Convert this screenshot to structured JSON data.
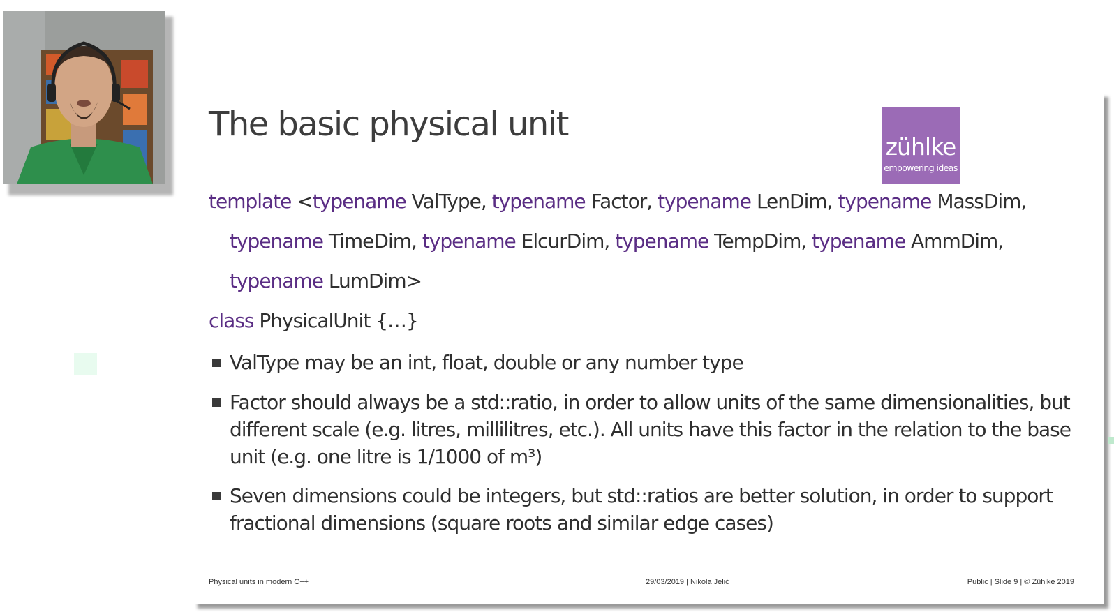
{
  "slide": {
    "title": "The basic physical unit",
    "logo": {
      "name": "zühlke",
      "tagline": "empowering ideas",
      "color": "#9b6bb6"
    },
    "code": {
      "line1": [
        {
          "t": "template",
          "k": true
        },
        {
          "t": " <",
          "k": false
        },
        {
          "t": "typename",
          "k": true
        },
        {
          "t": " ValType, ",
          "k": false
        },
        {
          "t": "typename",
          "k": true
        },
        {
          "t": " Factor, ",
          "k": false
        },
        {
          "t": "typename",
          "k": true
        },
        {
          "t": " LenDim, ",
          "k": false
        },
        {
          "t": "typename",
          "k": true
        },
        {
          "t": " MassDim,",
          "k": false
        }
      ],
      "line2": [
        {
          "t": "typename",
          "k": true
        },
        {
          "t": " TimeDim, ",
          "k": false
        },
        {
          "t": "typename",
          "k": true
        },
        {
          "t": " ElcurDim, ",
          "k": false
        },
        {
          "t": "typename",
          "k": true
        },
        {
          "t": " TempDim, ",
          "k": false
        },
        {
          "t": "typename",
          "k": true
        },
        {
          "t": " AmmDim,",
          "k": false
        }
      ],
      "line3": [
        {
          "t": "typename",
          "k": true
        },
        {
          "t": " LumDim>",
          "k": false
        }
      ],
      "line4": [
        {
          "t": "class",
          "k": true
        },
        {
          "t": " PhysicalUnit {…}",
          "k": false
        }
      ]
    },
    "bullets": [
      "ValType may be an int, float, double or any number type",
      "Factor should always be a std::ratio, in order to allow units of the same dimensionalities, but different scale (e.g. litres, millilitres, etc.). All units have this factor in the relation to the base unit (e.g. one litre is 1/1000 of m³)",
      "Seven dimensions could be integers, but std::ratios are better solution, in order to support fractional dimensions (square roots and similar edge cases)"
    ],
    "footer": {
      "left": "Physical units in modern C++",
      "center": "29/03/2019  |  Nikola Jelić",
      "right": "Public  |   Slide 9  |  © Zühlke 2019"
    },
    "keyword_color": "#5a2d84"
  }
}
